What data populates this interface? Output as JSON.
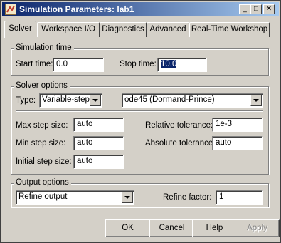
{
  "window": {
    "title": "Simulation Parameters: lab1",
    "minimize": "_",
    "maximize": "□",
    "close": "✕"
  },
  "tabs": [
    {
      "label": "Solver",
      "active": true
    },
    {
      "label": "Workspace I/O",
      "active": false
    },
    {
      "label": "Diagnostics",
      "active": false
    },
    {
      "label": "Advanced",
      "active": false
    },
    {
      "label": "Real-Time Workshop",
      "active": false
    }
  ],
  "simulation_time": {
    "title": "Simulation time",
    "start_label": "Start time:",
    "start_value": "0.0",
    "stop_label": "Stop time:",
    "stop_value": "10.0"
  },
  "solver_options": {
    "title": "Solver options",
    "type_label": "Type:",
    "type_value": "Variable-step",
    "solver_value": "ode45 (Dormand-Prince)",
    "max_step_label": "Max step size:",
    "max_step_value": "auto",
    "rel_tol_label": "Relative tolerance:",
    "rel_tol_value": "1e-3",
    "min_step_label": "Min step size:",
    "min_step_value": "auto",
    "abs_tol_label": "Absolute tolerance:",
    "abs_tol_value": "auto",
    "init_step_label": "Initial step size:",
    "init_step_value": "auto"
  },
  "output_options": {
    "title": "Output options",
    "mode_value": "Refine output",
    "refine_label": "Refine factor:",
    "refine_value": "1"
  },
  "buttons": {
    "ok": "OK",
    "cancel": "Cancel",
    "help": "Help",
    "apply": "Apply"
  },
  "icons": {
    "app": "matlab-icon"
  }
}
